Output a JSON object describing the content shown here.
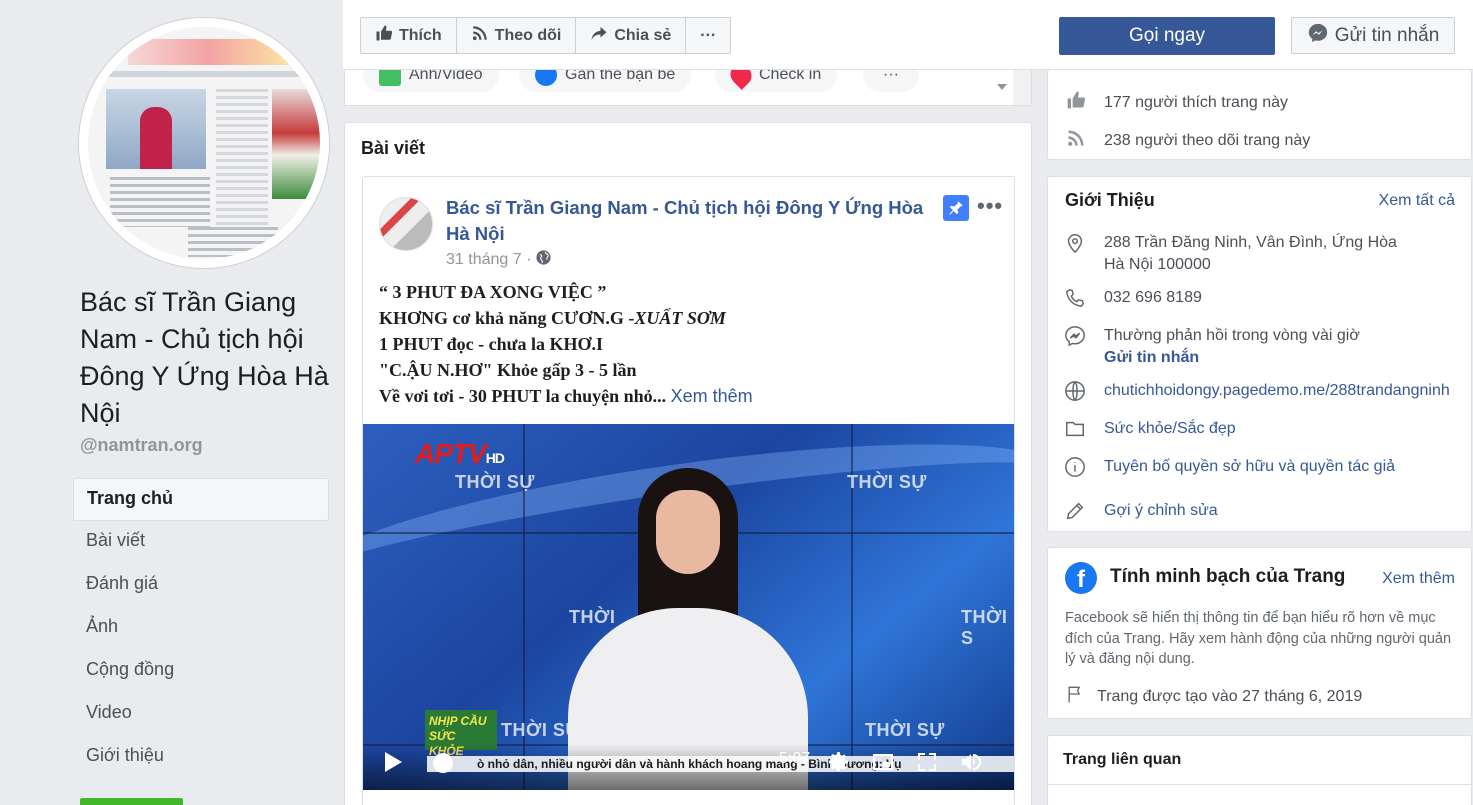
{
  "page": {
    "name": "Bác sĩ Trần Giang Nam - Chủ tịch hội Đông Y Ứng Hòa Hà Nội",
    "handle": "@namtran.org"
  },
  "nav": {
    "items": [
      {
        "label": "Trang chủ",
        "active": true
      },
      {
        "label": "Bài viết"
      },
      {
        "label": "Đánh giá"
      },
      {
        "label": "Ảnh"
      },
      {
        "label": "Cộng đồng"
      },
      {
        "label": "Video"
      },
      {
        "label": "Giới thiệu"
      }
    ]
  },
  "toolbar": {
    "like": "Thích",
    "follow": "Theo dõi",
    "share": "Chia sẻ",
    "more": "···",
    "call": "Gọi ngay",
    "message": "Gửi tin nhắn"
  },
  "composer": {
    "photo": "Ảnh/Video",
    "tag": "Gắn thẻ bạn bè",
    "checkin": "Check in",
    "more": "···"
  },
  "posts": {
    "title": "Bài viết",
    "post": {
      "author": "Bác sĩ Trần Giang Nam - Chủ tịch hội Đông Y Ứng Hòa Hà Nội",
      "date": "31 tháng 7 ·",
      "lines": [
        "“ 3 PHUT ĐA XONG VIỆC ”",
        "KHƠNG cơ khả năng CƯƠN.G -",
        "XUẤT SƠM",
        "1 PHUT đọc - chưa la KHƠ.I",
        "\"C.ẬU N.HƠ\" Khỏe gấp 3 - 5 lần",
        "Về vơi tơi - 30 PHUT la chuyện nhỏ..."
      ],
      "see_more": "Xem thêm",
      "video": {
        "logo": "APTV",
        "logo_hd": "HD",
        "overlay": "THỜI SỰ",
        "overlay_cut": "THỜI",
        "overlay_cut2": "THỜI S",
        "badge": "NHỊP CẦU SỨC KHỎE",
        "ticker": "ò nhỏ dân, nhiều người dân và hành khách hoang mang - Bình Dương: Vụ",
        "time": "5:07"
      }
    }
  },
  "stats": {
    "likes": "177 người thích trang này",
    "followers": "238 người theo dõi trang này"
  },
  "about": {
    "title": "Giới Thiệu",
    "see_all": "Xem tất cả",
    "address_line1": "288 Trần Đăng Ninh, Vân Đình, Ứng Hòa",
    "address_line2": "Hà Nội 100000",
    "phone": "032 696 8189",
    "response": "Thường phản hồi trong vòng vài giờ",
    "send_message": "Gửi tin nhắn",
    "website": "chutichhoidongy.pagedemo.me/288trandangninh",
    "category": "Sức khỏe/Sắc đẹp",
    "copyright": "Tuyên bố quyền sở hữu và quyền tác giả",
    "suggest": "Gợi ý chỉnh sửa"
  },
  "transparency": {
    "title": "Tính minh bạch của Trang",
    "see_more": "Xem thêm",
    "description": "Facebook sẽ hiển thị thông tin để bạn hiểu rõ hơn về mục đích của Trang. Hãy xem hành động của những người quản lý và đăng nội dung.",
    "created": "Trang được tạo vào 27 tháng 6, 2019"
  },
  "related": {
    "title": "Trang liên quan"
  },
  "colors": {
    "brand": "#365899",
    "facebook_blue": "#1877f2",
    "green": "#42b72a",
    "background": "#e9ebee"
  }
}
